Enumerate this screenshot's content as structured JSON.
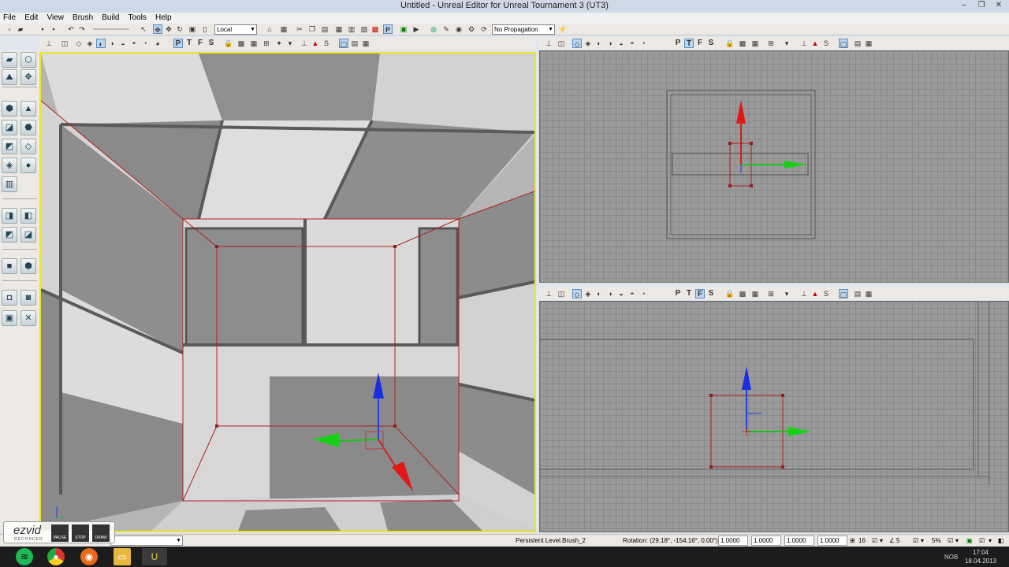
{
  "window": {
    "title": "Untitled - Unreal Editor for Unreal Tournament 3 (UT3)"
  },
  "menu": [
    "File",
    "Edit",
    "View",
    "Brush",
    "Build",
    "Tools",
    "Help"
  ],
  "toolbar": {
    "coord_system": "Local",
    "propagation": "No Propagation"
  },
  "viewport_toolbar": {
    "perspective": [
      "P",
      "T",
      "F",
      "S"
    ],
    "top_view": [
      "P",
      "T",
      "F",
      "S"
    ],
    "front_view": [
      "P",
      "T",
      "F",
      "S"
    ]
  },
  "status": {
    "selection": "Persistent Level.Brush_2",
    "rotation": "Rotation: (29.18°, -154.16°, 0.00°)",
    "scale_x": "1.0000",
    "scale_y": "1.0000",
    "scale_z": "1.0000",
    "scale_all": "1.0000",
    "grid_size": "16",
    "rot_snap": "5",
    "scale_snap": "5%"
  },
  "ezvid": {
    "logo": "ezvid",
    "sub": "RECORDER",
    "buttons": [
      "PAUSE",
      "STOP",
      "DRAW"
    ]
  },
  "clock": {
    "time": "17:04",
    "date": "18.04.2013",
    "lang": "NOB"
  },
  "colors": {
    "viewport_border": "#f1e61a",
    "accent": "#5a8ec8"
  }
}
